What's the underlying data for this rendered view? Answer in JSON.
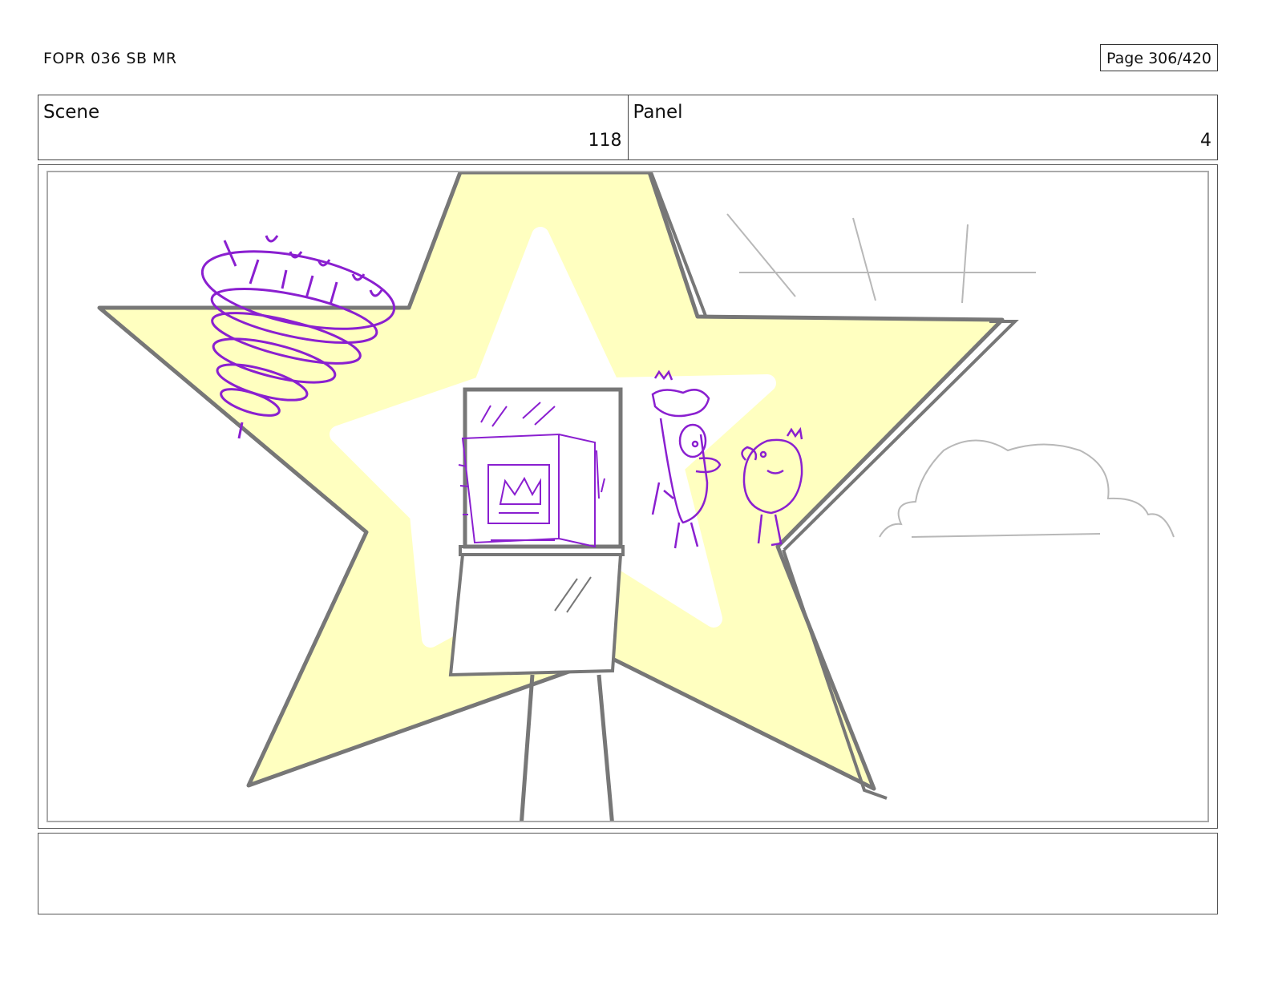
{
  "header": {
    "document_title": "FOPR 036 SB MR",
    "page_label": "Page 306/420"
  },
  "panel_info": {
    "scene_label": "Scene",
    "scene_value": "118",
    "panel_label": "Panel",
    "panel_value": "4"
  },
  "drawing": {
    "colors": {
      "star_fill": "#ffffc0",
      "star_glow": "#ffffff",
      "outline": "#777777",
      "sketch_purple": "#8a1fd0",
      "sky_sketch": "#b8b8b8"
    }
  },
  "notes": {
    "action_text": ""
  }
}
